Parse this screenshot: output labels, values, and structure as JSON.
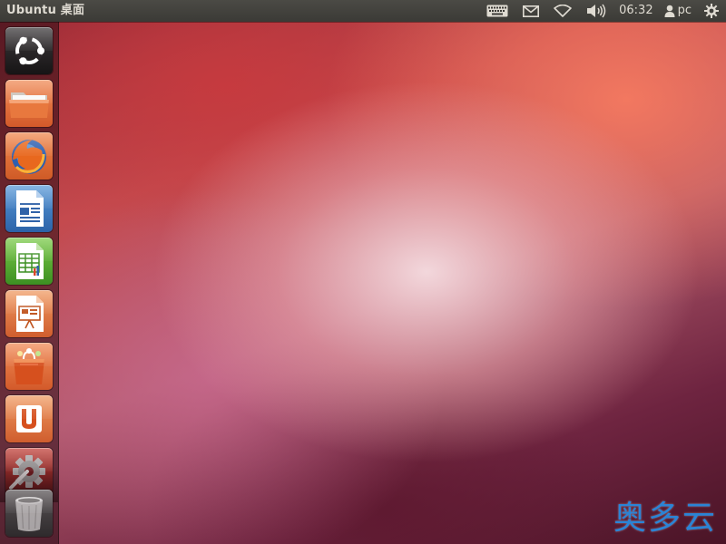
{
  "panel": {
    "title": "Ubuntu 桌面",
    "clock": "06:32",
    "user": "pc",
    "indicators": [
      "keyboard-icon",
      "mail-icon",
      "wifi-icon",
      "volume-icon",
      "user-icon",
      "power-gear-icon"
    ]
  },
  "launcher": {
    "items": [
      {
        "name": "dash-home",
        "icon": "ubuntu-logo-icon"
      },
      {
        "name": "home-folder",
        "icon": "folder-icon"
      },
      {
        "name": "firefox",
        "icon": "firefox-icon"
      },
      {
        "name": "libreoffice-writer",
        "icon": "writer-document-icon"
      },
      {
        "name": "libreoffice-calc",
        "icon": "calc-spreadsheet-icon"
      },
      {
        "name": "libreoffice-impress",
        "icon": "impress-presentation-icon"
      },
      {
        "name": "ubuntu-software-center",
        "icon": "shopping-bag-icon"
      },
      {
        "name": "ubuntu-one",
        "icon": "ubuntu-one-icon"
      },
      {
        "name": "system-settings",
        "icon": "settings-gear-icon"
      },
      {
        "name": "trash",
        "icon": "trash-icon"
      }
    ]
  },
  "watermark": "奥多云"
}
